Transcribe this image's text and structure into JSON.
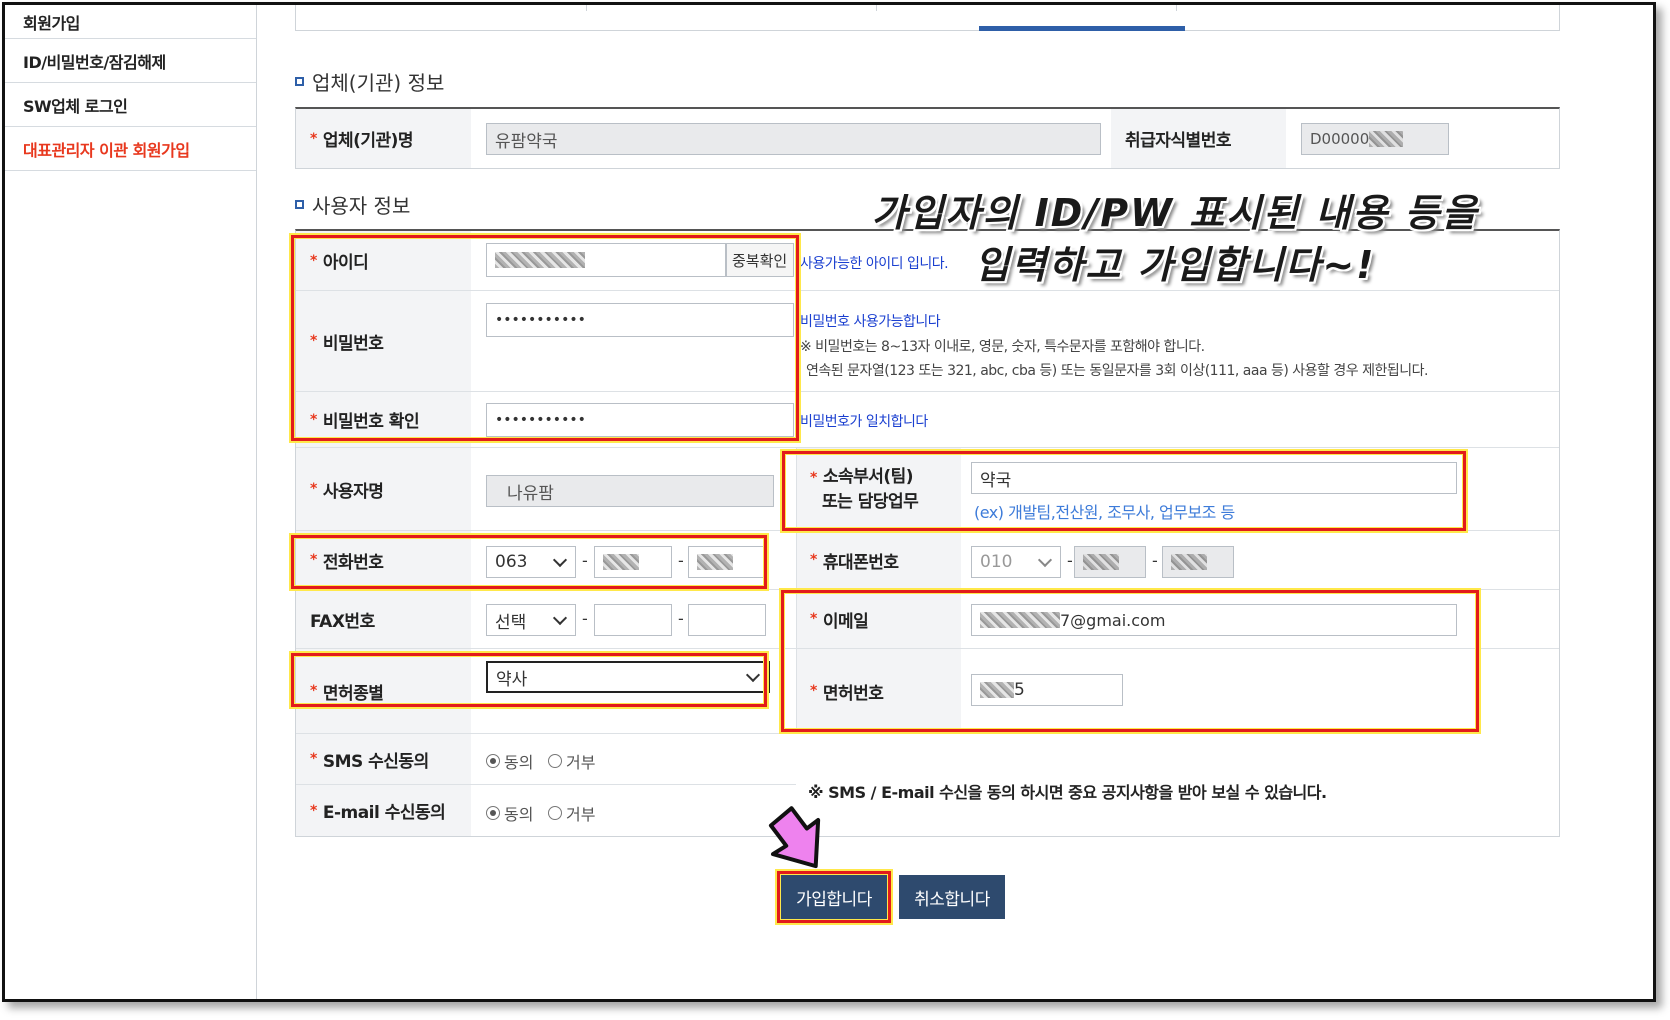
{
  "sidebar": {
    "items": [
      {
        "label": "회원가입"
      },
      {
        "label": "ID/비밀번호/잠김해제"
      },
      {
        "label": "SW업체 로그인"
      },
      {
        "label": "대표관리자 이관 회원가입"
      }
    ]
  },
  "company_section": {
    "title": "업체(기관) 정보",
    "name_label": "업체(기관)명",
    "name_value": "유팜약국",
    "id_label": "취급자식별번호",
    "id_value": "D00000"
  },
  "user_section": {
    "title": "사용자 정보",
    "id_label": "아이디",
    "dup_check_button": "중복확인",
    "id_ok_msg": "사용가능한 아이디 입니다.",
    "pw_label": "비밀번호",
    "pw_value": "•••••••••••",
    "pw_ok_msg": "비밀번호 사용가능합니다",
    "pw_rule_1": "※ 비밀번호는 8~13자 이내로, 영문, 숫자, 특수문자를 포함해야 합니다.",
    "pw_rule_2": "연속된 문자열(123 또는 321, abc, cba 등) 또는 동일문자를 3회 이상(111, aaa 등) 사용할 경우 제한됩니다.",
    "pw_confirm_label": "비밀번호 확인",
    "pw_confirm_value": "•••••••••••",
    "pw_match_msg": "비밀번호가 일치합니다",
    "username_label": "사용자명",
    "username_value": "나유팜",
    "dept_label_1": "소속부서(팀)",
    "dept_label_2": "또는 담당업무",
    "dept_value": "약국",
    "dept_example": "(ex) 개발팀,전산원, 조무사, 업무보조 등",
    "phone_label": "전화번호",
    "phone_area": "063",
    "mobile_label": "휴대폰번호",
    "mobile_prefix": "010",
    "fax_label": "FAX번호",
    "fax_select": "선택",
    "email_label": "이메일",
    "email_value": "7@gmai.com",
    "license_type_label": "면허종별",
    "license_type_value": "약사",
    "license_no_label": "면허번호",
    "license_no_value": "5",
    "sms_label": "SMS 수신동의",
    "email_agree_label": "E-mail 수신동의",
    "agree": "동의",
    "disagree": "거부",
    "notice": "※ SMS / E-mail 수신을 동의 하시면 중요 공지사항을 받아 보실 수 있습니다."
  },
  "buttons": {
    "join": "가입합니다",
    "cancel": "취소합니다"
  },
  "annotation": {
    "line1": "가입자의 ID/PW 표시된 내용 등을",
    "line2": "입력하고 가입합니다~!"
  },
  "colors": {
    "highlight": "#e21b1b",
    "button": "#2e4a6e",
    "accent_blue": "#2e5fa8",
    "required": "#e8381e",
    "arrow": "#ee82ee"
  }
}
